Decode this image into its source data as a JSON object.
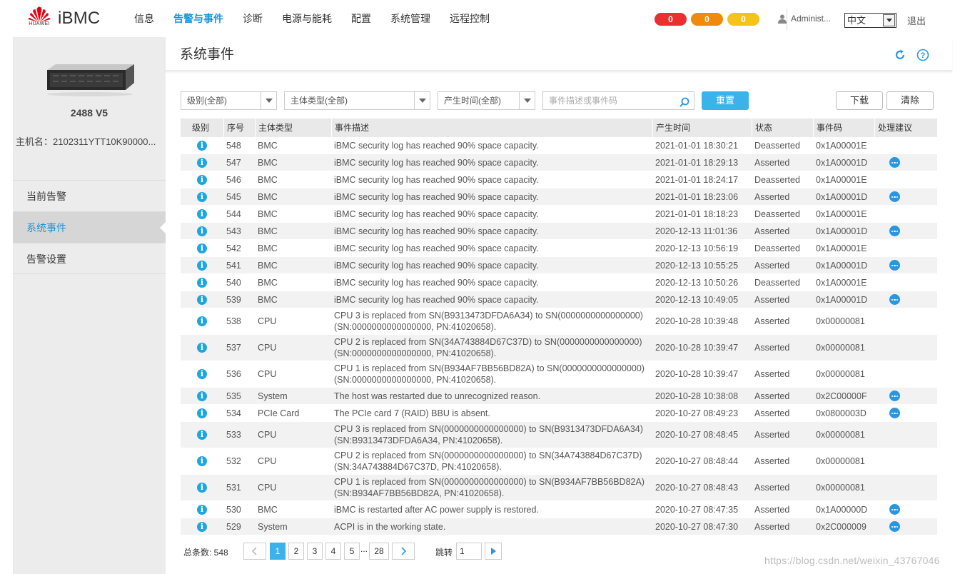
{
  "header": {
    "brand": "iBMC",
    "logo_sub": "HUAWEI",
    "nav": [
      {
        "label": "信息",
        "active": false
      },
      {
        "label": "告警与事件",
        "active": true
      },
      {
        "label": "诊断",
        "active": false
      },
      {
        "label": "电源与能耗",
        "active": false
      },
      {
        "label": "配置",
        "active": false
      },
      {
        "label": "系统管理",
        "active": false
      },
      {
        "label": "远程控制",
        "active": false
      }
    ],
    "alarms": [
      {
        "count": "0",
        "level": "critical",
        "color": "#e92f2f"
      },
      {
        "count": "0",
        "level": "major",
        "color": "#f08a0c"
      },
      {
        "count": "0",
        "level": "minor",
        "color": "#f5c31c"
      }
    ],
    "user": "Administ...",
    "language": "中文",
    "logout": "退出"
  },
  "sidebar": {
    "model": "2488 V5",
    "hostname": "主机名：2102311YTT10K90000...",
    "items": [
      {
        "label": "当前告警",
        "active": false
      },
      {
        "label": "系统事件",
        "active": true
      },
      {
        "label": "告警设置",
        "active": false
      }
    ]
  },
  "main": {
    "title": "系统事件",
    "filters": {
      "level": "级别(全部)",
      "subject": "主体类型(全部)",
      "time": "产生时间(全部)",
      "search_placeholder": "事件描述或事件码",
      "reset": "重置",
      "download": "下载",
      "clear": "清除"
    },
    "columns": [
      "级别",
      "序号",
      "主体类型",
      "事件描述",
      "产生时间",
      "状态",
      "事件码",
      "处理建议"
    ],
    "rows": [
      {
        "level": "info",
        "id": "548",
        "type": "BMC",
        "desc": "iBMC security log has reached 90% space capacity.",
        "time": "2021-01-01 18:30:21",
        "status": "Deasserted",
        "code": "0x1A00001E",
        "suggest": false
      },
      {
        "level": "info",
        "id": "547",
        "type": "BMC",
        "desc": "iBMC security log has reached 90% space capacity.",
        "time": "2021-01-01 18:29:13",
        "status": "Asserted",
        "code": "0x1A00001D",
        "suggest": true
      },
      {
        "level": "info",
        "id": "546",
        "type": "BMC",
        "desc": "iBMC security log has reached 90% space capacity.",
        "time": "2021-01-01 18:24:17",
        "status": "Deasserted",
        "code": "0x1A00001E",
        "suggest": false
      },
      {
        "level": "info",
        "id": "545",
        "type": "BMC",
        "desc": "iBMC security log has reached 90% space capacity.",
        "time": "2021-01-01 18:23:06",
        "status": "Asserted",
        "code": "0x1A00001D",
        "suggest": true
      },
      {
        "level": "info",
        "id": "544",
        "type": "BMC",
        "desc": "iBMC security log has reached 90% space capacity.",
        "time": "2021-01-01 18:18:23",
        "status": "Deasserted",
        "code": "0x1A00001E",
        "suggest": false
      },
      {
        "level": "info",
        "id": "543",
        "type": "BMC",
        "desc": "iBMC security log has reached 90% space capacity.",
        "time": "2020-12-13 11:01:36",
        "status": "Asserted",
        "code": "0x1A00001D",
        "suggest": true
      },
      {
        "level": "info",
        "id": "542",
        "type": "BMC",
        "desc": "iBMC security log has reached 90% space capacity.",
        "time": "2020-12-13 10:56:19",
        "status": "Deasserted",
        "code": "0x1A00001E",
        "suggest": false
      },
      {
        "level": "info",
        "id": "541",
        "type": "BMC",
        "desc": "iBMC security log has reached 90% space capacity.",
        "time": "2020-12-13 10:55:25",
        "status": "Asserted",
        "code": "0x1A00001D",
        "suggest": true
      },
      {
        "level": "info",
        "id": "540",
        "type": "BMC",
        "desc": "iBMC security log has reached 90% space capacity.",
        "time": "2020-12-13 10:50:26",
        "status": "Deasserted",
        "code": "0x1A00001E",
        "suggest": false
      },
      {
        "level": "info",
        "id": "539",
        "type": "BMC",
        "desc": "iBMC security log has reached 90% space capacity.",
        "time": "2020-12-13 10:49:05",
        "status": "Asserted",
        "code": "0x1A00001D",
        "suggest": true
      },
      {
        "level": "info",
        "id": "538",
        "type": "CPU",
        "desc": "CPU 3 is replaced from SN(B9313473DFDA6A34) to SN(0000000000000000) (SN:0000000000000000, PN:41020658).",
        "time": "2020-10-28 10:39:48",
        "status": "Asserted",
        "code": "0x00000081",
        "suggest": false
      },
      {
        "level": "info",
        "id": "537",
        "type": "CPU",
        "desc": "CPU 2 is replaced from SN(34A743884D67C37D) to SN(0000000000000000) (SN:0000000000000000, PN:41020658).",
        "time": "2020-10-28 10:39:47",
        "status": "Asserted",
        "code": "0x00000081",
        "suggest": false
      },
      {
        "level": "info",
        "id": "536",
        "type": "CPU",
        "desc": "CPU 1 is replaced from SN(B934AF7BB56BD82A) to SN(0000000000000000) (SN:0000000000000000, PN:41020658).",
        "time": "2020-10-28 10:39:47",
        "status": "Asserted",
        "code": "0x00000081",
        "suggest": false
      },
      {
        "level": "info",
        "id": "535",
        "type": "System",
        "desc": "The host was restarted due to unrecognized reason.",
        "time": "2020-10-28 10:38:08",
        "status": "Asserted",
        "code": "0x2C00000F",
        "suggest": true
      },
      {
        "level": "info",
        "id": "534",
        "type": "PCIe Card",
        "desc": "The PCIe card 7 (RAID) BBU is absent.",
        "time": "2020-10-27 08:49:23",
        "status": "Asserted",
        "code": "0x0800003D",
        "suggest": true
      },
      {
        "level": "info",
        "id": "533",
        "type": "CPU",
        "desc": "CPU 3 is replaced from SN(0000000000000000) to SN(B9313473DFDA6A34) (SN:B9313473DFDA6A34, PN:41020658).",
        "time": "2020-10-27 08:48:45",
        "status": "Asserted",
        "code": "0x00000081",
        "suggest": false
      },
      {
        "level": "info",
        "id": "532",
        "type": "CPU",
        "desc": "CPU 2 is replaced from SN(0000000000000000) to SN(34A743884D67C37D) (SN:34A743884D67C37D, PN:41020658).",
        "time": "2020-10-27 08:48:44",
        "status": "Asserted",
        "code": "0x00000081",
        "suggest": false
      },
      {
        "level": "info",
        "id": "531",
        "type": "CPU",
        "desc": "CPU 1 is replaced from SN(0000000000000000) to SN(B934AF7BB56BD82A) (SN:B934AF7BB56BD82A, PN:41020658).",
        "time": "2020-10-27 08:48:43",
        "status": "Asserted",
        "code": "0x00000081",
        "suggest": false
      },
      {
        "level": "info",
        "id": "530",
        "type": "BMC",
        "desc": "iBMC is restarted after AC power supply is restored.",
        "time": "2020-10-27 08:47:35",
        "status": "Asserted",
        "code": "0x1A00000D",
        "suggest": true
      },
      {
        "level": "info",
        "id": "529",
        "type": "System",
        "desc": "ACPI is in the working state.",
        "time": "2020-10-27 08:47:30",
        "status": "Asserted",
        "code": "0x2C000009",
        "suggest": true
      }
    ],
    "pagination": {
      "total_label": "总条数: 548",
      "pages": [
        "1",
        "2",
        "3",
        "4",
        "5"
      ],
      "ellipsis": "...",
      "last_page": "28",
      "jump_label": "跳转",
      "jump_value": "1"
    }
  },
  "watermark": "https://blog.csdn.net/weixin_43767046",
  "colors": {
    "accent": "#1895d6",
    "primary_button": "#3bb2ea",
    "info_icon": "#1fa6e0"
  }
}
